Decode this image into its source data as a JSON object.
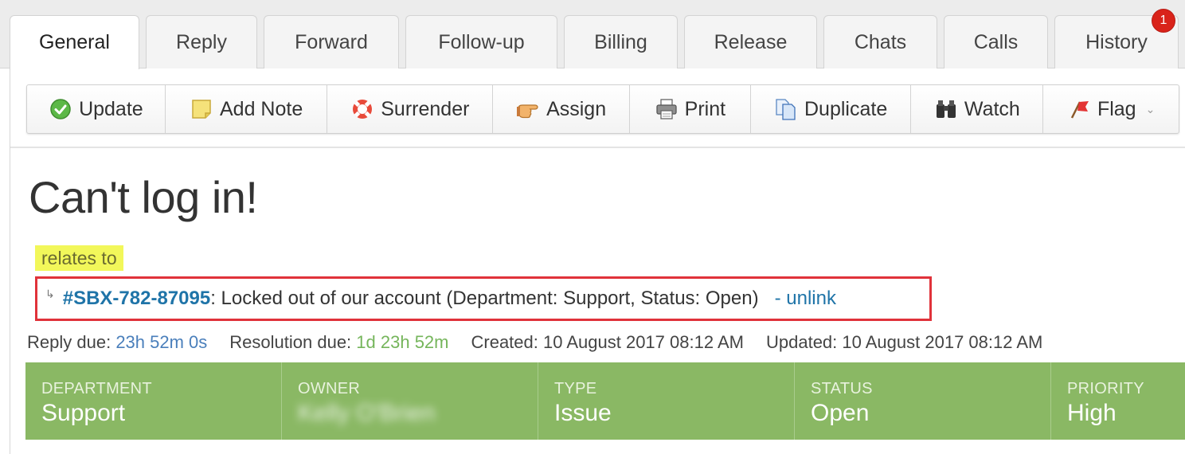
{
  "tabs": [
    {
      "label": "General",
      "active": true
    },
    {
      "label": "Reply"
    },
    {
      "label": "Forward"
    },
    {
      "label": "Follow-up"
    },
    {
      "label": "Billing"
    },
    {
      "label": "Release"
    },
    {
      "label": "Chats"
    },
    {
      "label": "Calls"
    },
    {
      "label": "History",
      "badge": "1"
    }
  ],
  "toolbar": {
    "update": "Update",
    "add_note": "Add Note",
    "surrender": "Surrender",
    "assign": "Assign",
    "print": "Print",
    "duplicate": "Duplicate",
    "watch": "Watch",
    "flag": "Flag"
  },
  "ticket": {
    "title": "Can't log in!",
    "relates_label": "relates to",
    "related": {
      "id": "#SBX-782-87095",
      "summary": ": Locked out of our account (Department: Support, Status: Open)",
      "unlink": "- unlink"
    }
  },
  "meta": {
    "reply_due_label": "Reply due:",
    "reply_due_value": "23h 52m 0s",
    "resolution_due_label": "Resolution due:",
    "resolution_due_value": "1d 23h 52m",
    "created": "Created: 10 August 2017 08:12 AM",
    "updated": "Updated: 10 August 2017 08:12 AM"
  },
  "info": {
    "department_label": "DEPARTMENT",
    "department_value": "Support",
    "owner_label": "OWNER",
    "owner_value": "Kelly O'Brien",
    "type_label": "TYPE",
    "type_value": "Issue",
    "status_label": "STATUS",
    "status_value": "Open",
    "priority_label": "PRIORITY",
    "priority_value": "High"
  },
  "colors": {
    "info_bar": "#8ab864",
    "link": "#1f74a8",
    "highlight": "#f2f75a",
    "outline": "#e0323a",
    "badge": "#d9231a"
  }
}
